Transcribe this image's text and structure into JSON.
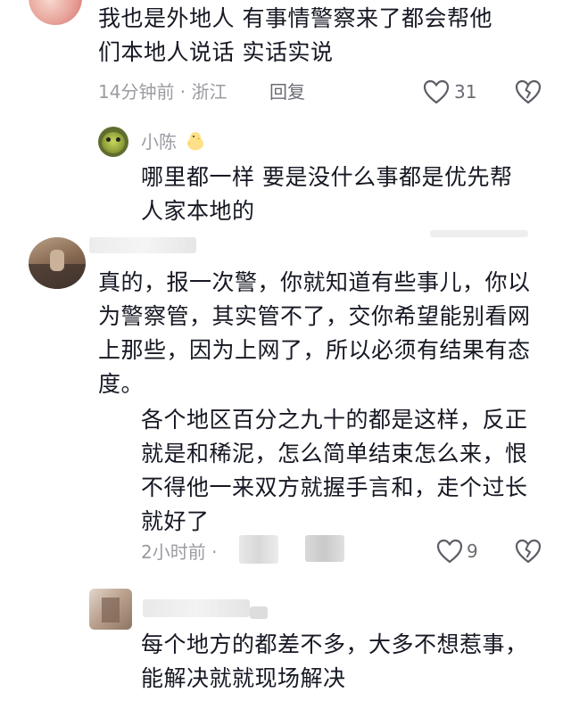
{
  "comments": [
    {
      "text": "我也是外地人 有事情警察来了都会帮他们本地人说话 实话实说",
      "meta": "14分钟前 · 浙江",
      "reply_label": "回复",
      "likes": "31",
      "replies": [
        {
          "author": "小陈",
          "text": "哪里都一样 要是没什么事都是优先帮人家本地的"
        }
      ]
    },
    {
      "text": "真的，报一次警，你就知道有些事儿，你以为警察管，其实管不了，交你希望能别看网上那些，因为上网了，所以必须有结果有态度。",
      "replies": [
        {
          "text": "各个地区百分之九十的都是这样，反正就是和稀泥，怎么简单结束怎么来，恨不得他一来双方就握手言和，走个过长就好了",
          "meta": "2小时前 ·",
          "likes": "9"
        }
      ]
    },
    {
      "text": "每个地方的都差不多，大多不想惹事，能解决就就现场解决"
    }
  ],
  "icons": {
    "like": "heart-outline-icon",
    "dislike": "broken-heart-icon",
    "badge": "chick-emoji-icon"
  }
}
